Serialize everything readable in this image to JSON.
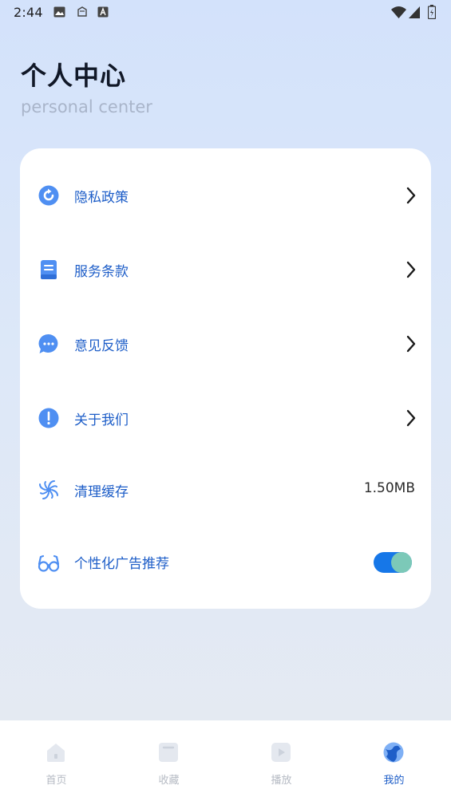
{
  "status_bar": {
    "time": "2:44",
    "left_icons": [
      "image-icon",
      "cloud-icon",
      "text-icon"
    ],
    "right_icons": [
      "wifi-icon",
      "signal-icon",
      "battery-icon"
    ]
  },
  "header": {
    "title": "个人中心",
    "subtitle": "personal center"
  },
  "menu": {
    "items": [
      {
        "label": "隐私政策",
        "icon": "privacy-icon",
        "trailing": "chevron"
      },
      {
        "label": "服务条款",
        "icon": "book-icon",
        "trailing": "chevron"
      },
      {
        "label": "意见反馈",
        "icon": "chat-icon",
        "trailing": "chevron"
      },
      {
        "label": "关于我们",
        "icon": "info-icon",
        "trailing": "chevron"
      },
      {
        "label": "清理缓存",
        "icon": "spiral-icon",
        "trailing": "value",
        "value": "1.50MB"
      },
      {
        "label": "个性化广告推荐",
        "icon": "glasses-icon",
        "trailing": "toggle",
        "toggle_on": true
      }
    ]
  },
  "tabbar": {
    "tabs": [
      {
        "label": "首页",
        "icon": "home-icon",
        "active": false
      },
      {
        "label": "收藏",
        "icon": "bookmark-icon",
        "active": false
      },
      {
        "label": "播放",
        "icon": "play-icon",
        "active": false
      },
      {
        "label": "我的",
        "icon": "profile-icon",
        "active": true
      }
    ]
  },
  "colors": {
    "accent": "#1677e8",
    "label": "#1e5ec8",
    "inactive_tab": "#b5bac3",
    "toggle_knob": "#7cc9b8"
  }
}
